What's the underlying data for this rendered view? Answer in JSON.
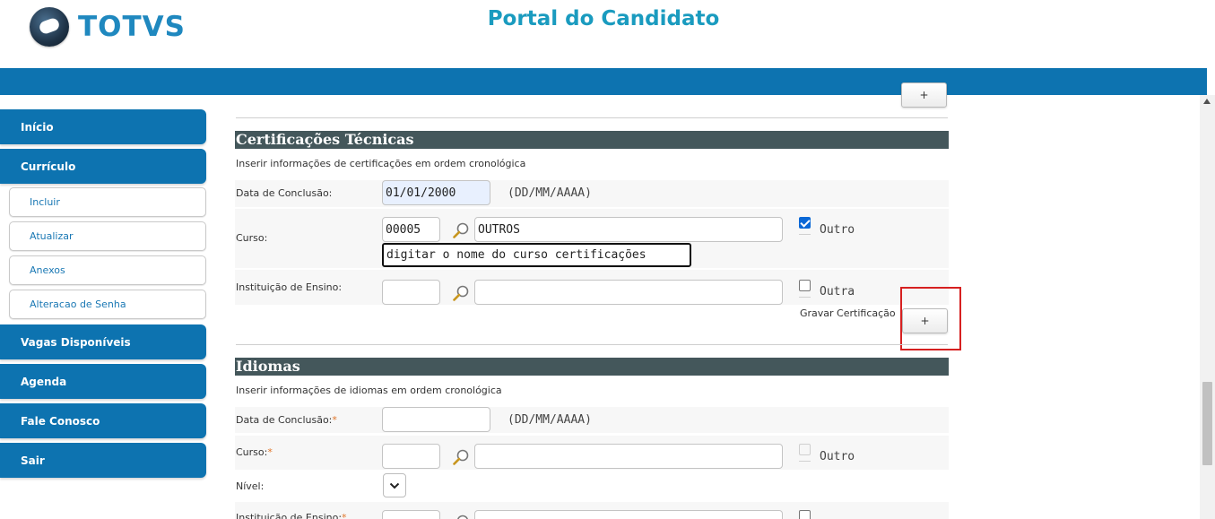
{
  "header": {
    "brand": "TOTVS",
    "title": "Portal do Candidato"
  },
  "sidebar": {
    "items": [
      {
        "label": "Início"
      },
      {
        "label": "Currículo"
      },
      {
        "label": "Incluir"
      },
      {
        "label": "Atualizar"
      },
      {
        "label": "Anexos"
      },
      {
        "label": "Alteracao de Senha"
      },
      {
        "label": "Vagas Disponíveis"
      },
      {
        "label": "Agenda"
      },
      {
        "label": "Fale Conosco"
      },
      {
        "label": "Sair"
      }
    ]
  },
  "top_add_button": "+",
  "certificacoes": {
    "title": "Certificações Técnicas",
    "description": "Inserir informações de certificações em ordem cronológica",
    "data_conclusao": {
      "label": "Data de Conclusão:",
      "value": "01/01/2000",
      "hint": "(DD/MM/AAAA)"
    },
    "curso": {
      "label": "Curso:",
      "code": "00005",
      "name": "OUTROS",
      "other_label": "Outro",
      "other_checked": true,
      "free_text": "digitar o nome do curso certificações"
    },
    "instituicao": {
      "label": "Instituição de Ensino:",
      "code": "",
      "name": "",
      "other_label": "Outra",
      "other_checked": false
    },
    "gravar_label": "Gravar Certificação",
    "add_button": "+"
  },
  "idiomas": {
    "title": "Idiomas",
    "description": "Inserir informações de idiomas em ordem cronológica",
    "data_conclusao": {
      "label": "Data de Conclusão:",
      "required_mark": "*",
      "value": "",
      "hint": "(DD/MM/AAAA)"
    },
    "curso": {
      "label": "Curso:",
      "required_mark": "*",
      "code": "",
      "name": "",
      "other_label": "Outro"
    },
    "nivel": {
      "label": "Nível:"
    },
    "instituicao": {
      "label": "Instituição de Ensino:",
      "required_mark": "*"
    }
  },
  "colors": {
    "brand_blue": "#0d73b0",
    "title_teal": "#1a9bbf",
    "section_header": "#44575b",
    "highlight_red": "#d62020"
  },
  "icons": [
    "search-icon",
    "chevron-down-icon",
    "checkbox-icon"
  ]
}
